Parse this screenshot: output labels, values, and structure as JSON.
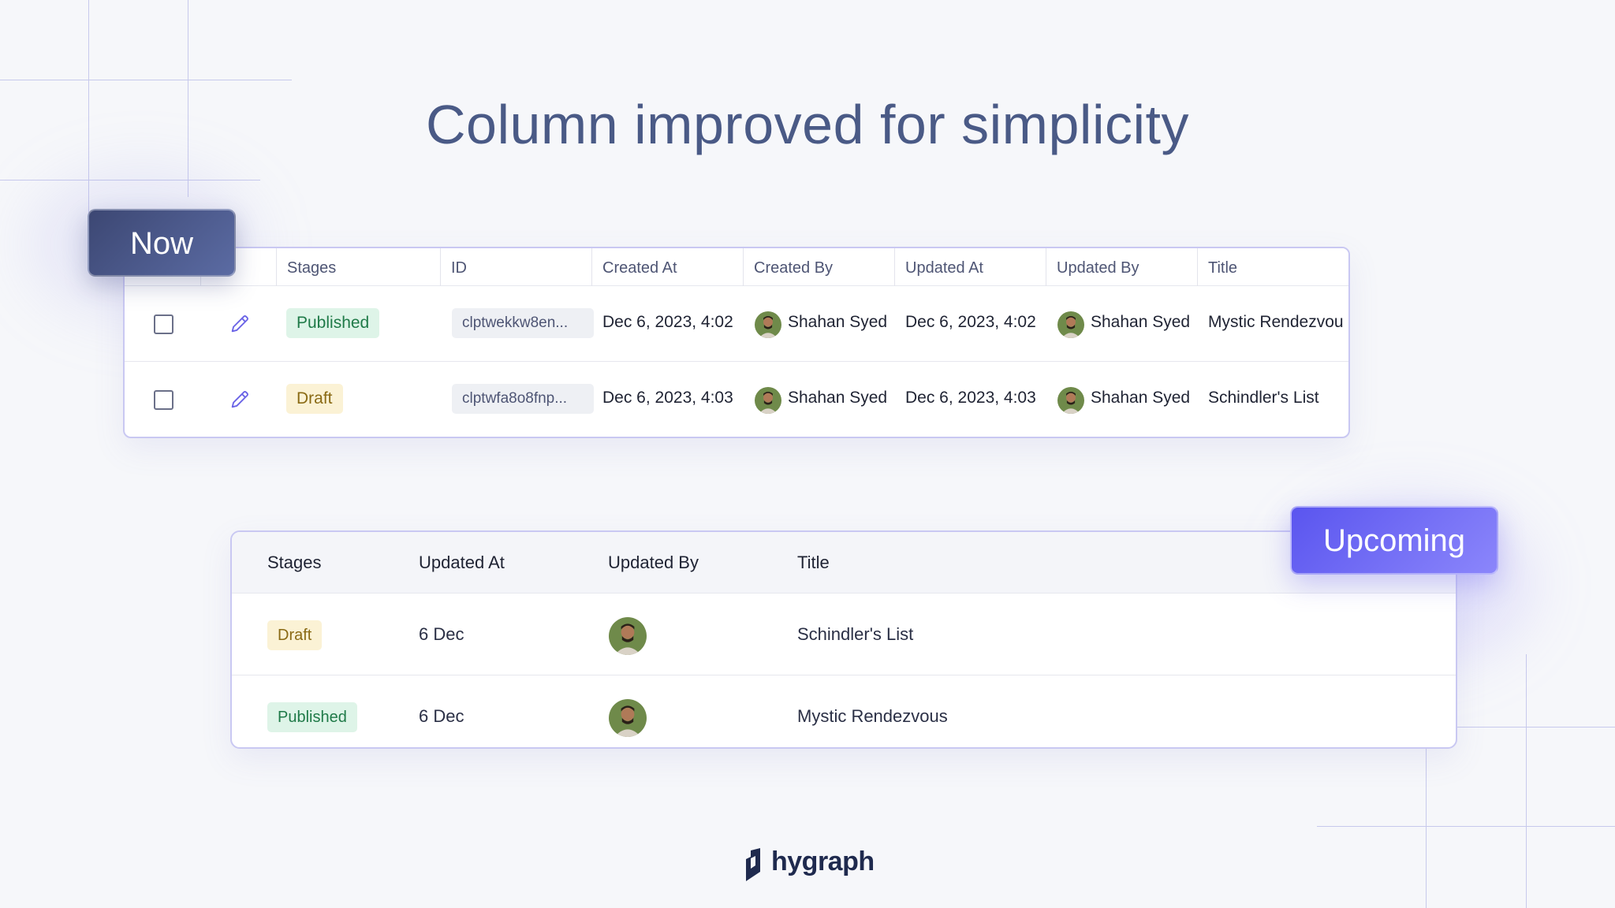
{
  "headline": "Column improved for simplicity",
  "now": {
    "tag": "Now",
    "columns": [
      "Stages",
      "ID",
      "Created At",
      "Created By",
      "Updated At",
      "Updated By",
      "Title"
    ],
    "rows": [
      {
        "stage": "Published",
        "id": "clptwekkw8en...",
        "created_at": "Dec 6, 2023, 4:02",
        "created_by": "Shahan Syed",
        "updated_at": "Dec 6, 2023, 4:02",
        "updated_by": "Shahan Syed",
        "title": "Mystic Rendezvou"
      },
      {
        "stage": "Draft",
        "id": "clptwfa8o8fnp...",
        "created_at": "Dec 6, 2023, 4:03",
        "created_by": "Shahan Syed",
        "updated_at": "Dec 6, 2023, 4:03",
        "updated_by": "Shahan Syed",
        "title": "Schindler's List"
      }
    ]
  },
  "upcoming": {
    "tag": "Upcoming",
    "columns": [
      "Stages",
      "Updated At",
      "Updated By",
      "Title"
    ],
    "rows": [
      {
        "stage": "Draft",
        "updated_at": "6 Dec",
        "title": "Schindler's List"
      },
      {
        "stage": "Published",
        "updated_at": "6 Dec",
        "title": "Mystic Rendezvous"
      }
    ]
  },
  "logo": {
    "text": "hygraph"
  },
  "colors": {
    "published_bg": "#def4e8",
    "published_text": "#1f7a48",
    "draft_bg": "#fbf2d5",
    "draft_text": "#8a6a14",
    "now_tag": "#3c4773",
    "upcoming_tag": "#5a55ef",
    "card_border": "#c9c8f2"
  },
  "icons": [
    "checkbox-icon",
    "pencil-icon",
    "avatar-icon",
    "hygraph-logo-icon"
  ]
}
